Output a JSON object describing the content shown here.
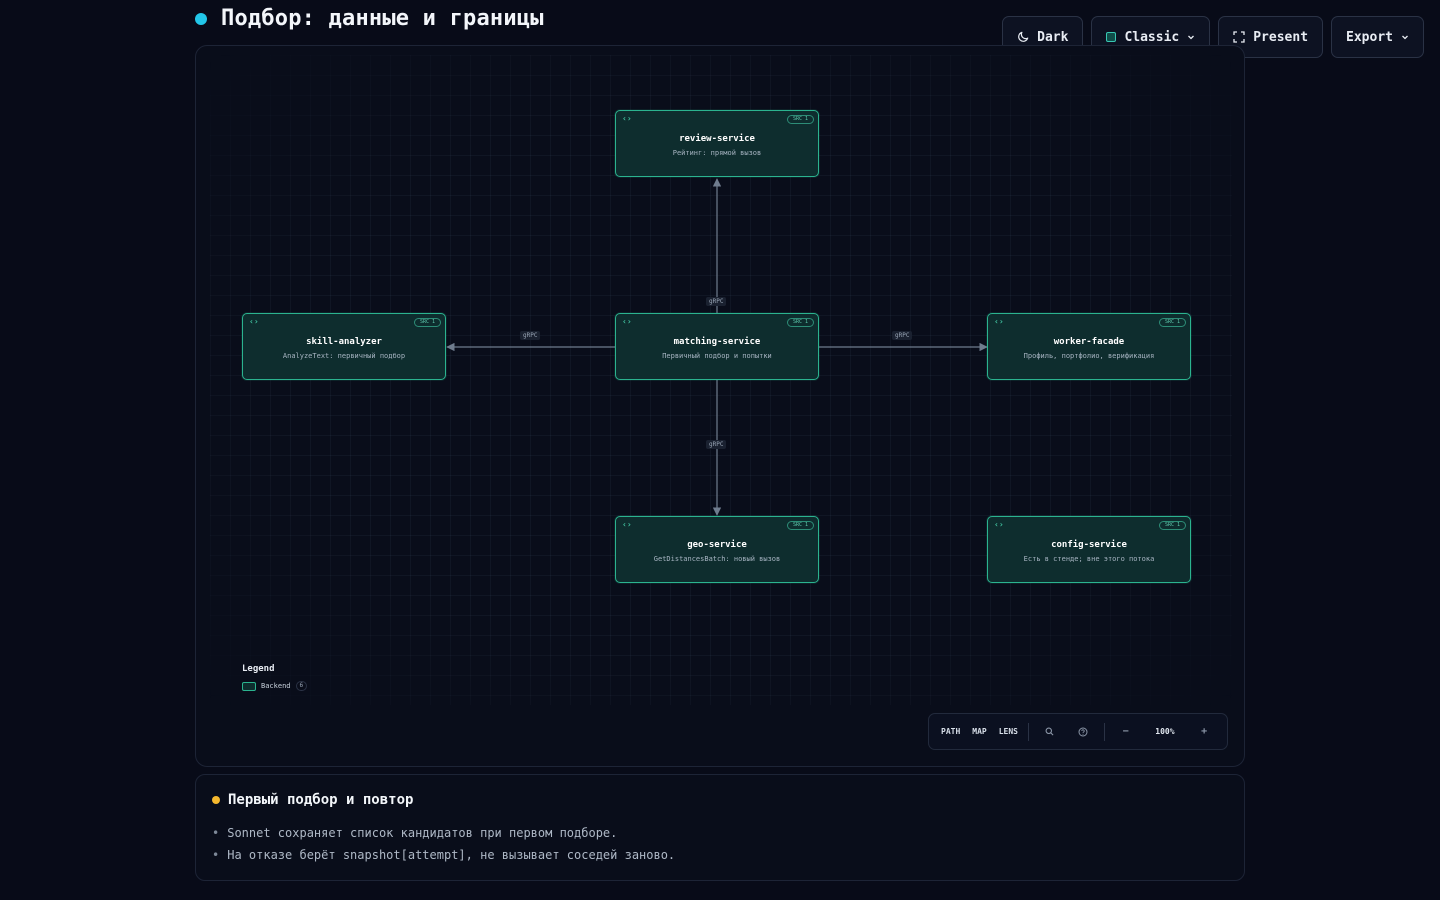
{
  "page": {
    "title": "Подбор: данные и границы",
    "accent_color": "#22c6e8"
  },
  "toolbar": {
    "theme_label": "Dark",
    "theme_icon": "moon-icon",
    "style_label": "Classic",
    "present_label": "Present",
    "present_icon": "fullscreen-icon",
    "export_label": "Export"
  },
  "diagram": {
    "nodes": [
      {
        "id": "review-service",
        "name": "review-service",
        "description": "Рейтинг: прямой вызов",
        "badge": "SRC 1"
      },
      {
        "id": "skill-analyzer",
        "name": "skill-analyzer",
        "description": "AnalyzeText: первичный подбор",
        "badge": "SRC 1"
      },
      {
        "id": "matching-service",
        "name": "matching-service",
        "description": "Первичный подбор и попытки",
        "badge": "SRC 1"
      },
      {
        "id": "worker-facade",
        "name": "worker-facade",
        "description": "Профиль, портфолио, верификация",
        "badge": "SRC 1"
      },
      {
        "id": "geo-service",
        "name": "geo-service",
        "description": "GetDistancesBatch: новый вызов",
        "badge": "SRC 1"
      },
      {
        "id": "config-service",
        "name": "config-service",
        "description": "Есть в стенде; вне этого потока",
        "badge": "SRC 1"
      }
    ],
    "edges": [
      {
        "from": "matching-service",
        "to": "review-service",
        "label": "gRPC"
      },
      {
        "from": "matching-service",
        "to": "skill-analyzer",
        "label": "gRPC"
      },
      {
        "from": "matching-service",
        "to": "worker-facade",
        "label": "gRPC"
      },
      {
        "from": "matching-service",
        "to": "geo-service",
        "label": "gRPC"
      }
    ],
    "node_color": "#2bb38f",
    "node_fill": "#0e2d2e",
    "edge_color": "#6f7c8e"
  },
  "legend": {
    "title": "Legend",
    "items": [
      {
        "label": "Backend",
        "count": "6"
      }
    ]
  },
  "controls": {
    "path_label": "PATH",
    "map_label": "MAP",
    "lens_label": "LENS",
    "zoom_value": "100%",
    "zoom_out": "−",
    "zoom_in": "+"
  },
  "notes": {
    "title": "Первый подбор и повтор",
    "dot_color": "#f5b82e",
    "items": [
      "Sonnet сохраняет список кандидатов при первом подборе.",
      "На отказе берёт snapshot[attempt], не вызывает соседей заново."
    ]
  }
}
